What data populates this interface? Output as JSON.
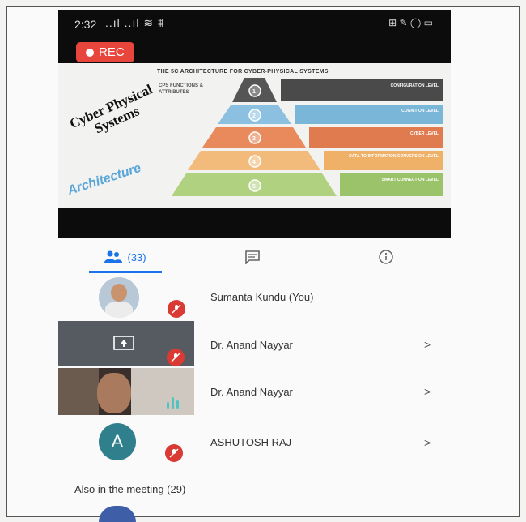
{
  "status_bar": {
    "time": "2:32",
    "signal": "..ıl ..ıl ≋ ⩩",
    "right_icons": "⊞ ✎ ◯ ▭"
  },
  "recording": {
    "label": "REC"
  },
  "slide": {
    "title": "THE 5C ARCHITECTURE FOR CYBER-PHYSICAL SYSTEMS",
    "side_text": "CPS FUNCTIONS & ATTRIBUTES",
    "rotated_title": "Cyber Physical Systems",
    "rotated_subtitle": "Architecture",
    "levels": [
      {
        "num": "1",
        "label": "CONFIGURATION LEVEL",
        "color": "#4a4a4a"
      },
      {
        "num": "2",
        "label": "COGNITION LEVEL",
        "color": "#7ab6d8"
      },
      {
        "num": "3",
        "label": "CYBER LEVEL",
        "color": "#e07b4f"
      },
      {
        "num": "4",
        "label": "DATA-TO-INFORMATION CONVERSION LEVEL",
        "color": "#efb168"
      },
      {
        "num": "5",
        "label": "SMART CONNECTION LEVEL",
        "color": "#9bc46a"
      }
    ]
  },
  "tabs": {
    "people_count": "(33)",
    "chat": "chat",
    "info": "info"
  },
  "participants": [
    {
      "name": "Sumanta Kundu (You)",
      "type": "photo"
    },
    {
      "name": "Dr. Anand Nayyar",
      "type": "screen"
    },
    {
      "name": "Dr. Anand Nayyar",
      "type": "video"
    },
    {
      "name": "ASHUTOSH RAJ",
      "type": "initial",
      "initial": "A"
    }
  ],
  "chevron": ">",
  "also_in_meeting": "Also in the meeting (29)"
}
